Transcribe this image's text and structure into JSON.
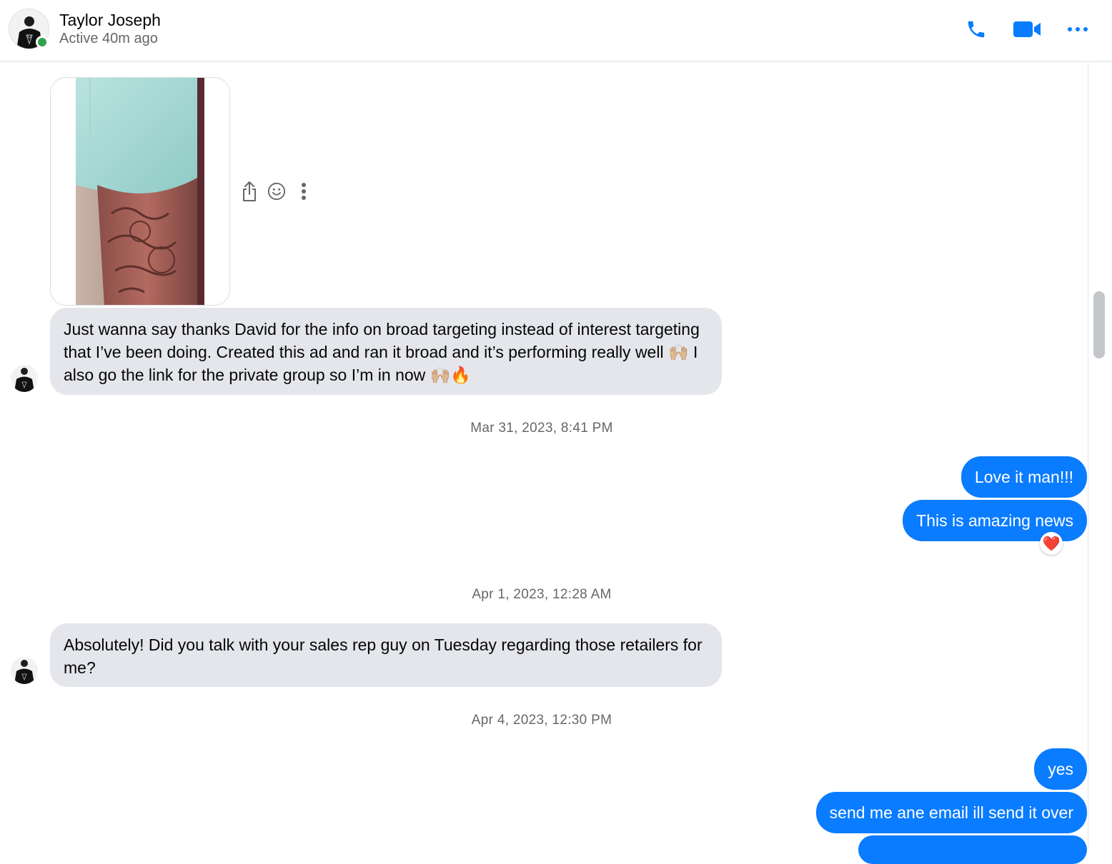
{
  "header": {
    "name": "Taylor Joseph",
    "status": "Active 40m ago",
    "actions": [
      "phone-icon",
      "video-camera-icon",
      "more-icon"
    ],
    "accent_color": "#0a7cff",
    "presence_color": "#31a24c"
  },
  "messages": {
    "msg1": {
      "text": "Just wanna say thanks David for the info on broad targeting instead of interest targeting that I’ve been doing. Created this ad and ran it broad and it’s performing really well 🙌🏼 I also go the link for the private group so I’m in now 🙌🏼🔥"
    },
    "ts1": "Mar 31, 2023, 8:41 PM",
    "out1": "Love it man!!!",
    "out2": "This is amazing news",
    "reaction2": "❤️",
    "ts2": "Apr 1, 2023, 12:28 AM",
    "msg2": "Absolutely! Did you talk with your sales rep guy on Tuesday regarding those retailers for me?",
    "ts3": "Apr 4, 2023, 12:30 PM",
    "out3": "yes",
    "out4": "send me ane email ill send it over"
  },
  "hover_actions": [
    "share-icon",
    "emoji-react-icon",
    "more-vertical-icon"
  ],
  "colors": {
    "incoming_bubble": "#e4e6eb",
    "outgoing_bubble": "#0a7cff",
    "timestamp_text": "#65676b"
  }
}
